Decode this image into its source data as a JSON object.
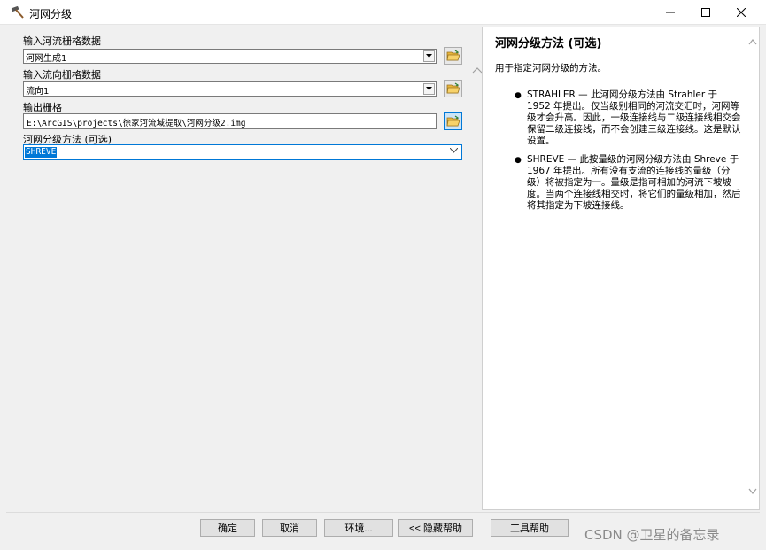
{
  "window": {
    "title": "河网分级",
    "icon": "hammer-icon"
  },
  "form": {
    "fields": [
      {
        "label": "输入河流栅格数据",
        "value": "河网生成1"
      },
      {
        "label": "输入流向栅格数据",
        "value": "流向1"
      },
      {
        "label": "输出栅格",
        "value": "E:\\ArcGIS\\projects\\徐家河流域提取\\河网分级2.img"
      },
      {
        "label": "河网分级方法 (可选)",
        "value": "SHREVE"
      }
    ]
  },
  "help": {
    "title": "河网分级方法 (可选)",
    "intro": "用于指定河网分级的方法。",
    "bullets": [
      "STRAHLER — 此河网分级方法由 Strahler 于 1952 年提出。仅当级别相同的河流交汇时，河网等级才会升高。因此，一级连接线与二级连接线相交会保留二级连接线，而不会创建三级连接线。这是默认设置。",
      "SHREVE — 此按量级的河网分级方法由 Shreve 于 1967 年提出。所有没有支流的连接线的量级（分级）将被指定为一。量级是指可相加的河流下坡坡度。当两个连接线相交时，将它们的量级相加，然后将其指定为下坡连接线。"
    ]
  },
  "buttons": {
    "ok": "确定",
    "cancel": "取消",
    "environments": "环境...",
    "hide_help": "<< 隐藏帮助",
    "tool_help": "工具帮助"
  },
  "watermark": "CSDN @卫星的备忘录",
  "colors": {
    "accent": "#0078d7"
  }
}
